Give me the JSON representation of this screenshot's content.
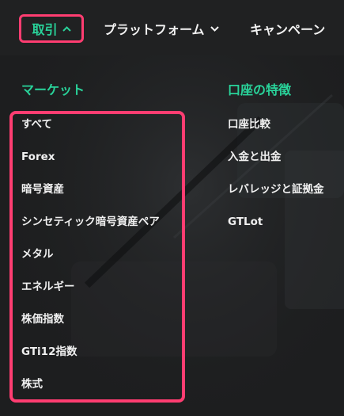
{
  "nav": {
    "trade_label": "取引",
    "platform_label": "プラットフォーム",
    "campaign_label": "キャンペーン"
  },
  "market": {
    "title": "マーケット",
    "items": [
      "すべて",
      "Forex",
      "暗号資産",
      "シンセティック暗号資産ペア",
      "メタル",
      "エネルギー",
      "株価指数",
      "GTi12指数",
      "株式"
    ]
  },
  "account": {
    "title": "口座の特徴",
    "items": [
      "口座比較",
      "入金と出金",
      "レバレッジと証拠金",
      "GTLot"
    ]
  },
  "colors": {
    "accent_green": "#29d39a",
    "highlight_pink": "#ff3d71",
    "background": "#1d1e1f"
  },
  "icons": {
    "trade_chevron": "chevron-up-icon",
    "platform_chevron": "chevron-down-icon"
  }
}
